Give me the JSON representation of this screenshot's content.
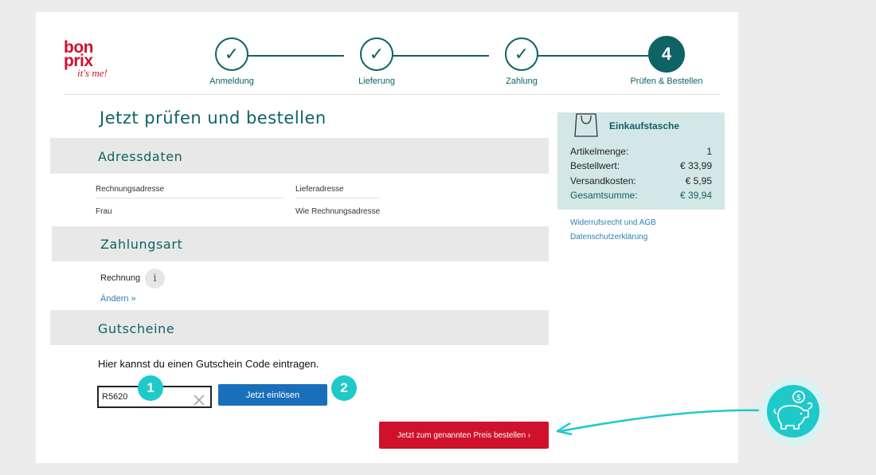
{
  "logo": {
    "line1": "bon",
    "line2": "prix",
    "line3": "it's me!"
  },
  "steps": [
    {
      "label": "Anmeldung",
      "mark": "✓"
    },
    {
      "label": "Lieferung",
      "mark": "✓"
    },
    {
      "label": "Zahlung",
      "mark": "✓"
    },
    {
      "label": "Prüfen & Bestellen",
      "mark": "4"
    }
  ],
  "page_title": "Jetzt prüfen und bestellen",
  "address": {
    "section_title": "Adressdaten",
    "billing_header": "Rechnungsadresse",
    "billing_value": "Frau",
    "shipping_header": "Lieferadresse",
    "shipping_value": "Wie Rechnungsadresse"
  },
  "payment": {
    "section_title": "Zahlungsart",
    "method": "Rechnung",
    "info_glyph": "i",
    "change_link": "Ändern »"
  },
  "voucher": {
    "section_title": "Gutscheine",
    "hint": "Hier kannst du einen Gutschein Code eintragen.",
    "code_value": "R5620",
    "redeem_label": "Jetzt einlösen"
  },
  "order_button_label": "Jetzt zum genannten Preis bestellen  ›",
  "badges": [
    "1",
    "2"
  ],
  "summary": {
    "title": "Einkaufstasche",
    "rows": [
      {
        "label": "Artikelmenge:",
        "value": "1"
      },
      {
        "label": "Bestellwert:",
        "value": "€ 33,99"
      },
      {
        "label": "Versandkosten:",
        "value": "€ 5,95"
      },
      {
        "label": "Gesamtsumme:",
        "value": "€ 39,94"
      }
    ]
  },
  "links": {
    "terms": "Widerrufsrecht und AGB",
    "privacy": "Datenschutzerklärung"
  },
  "colors": {
    "brand": "#d0112b",
    "primary_teal": "#0e6365",
    "accent_cyan": "#1fc9c9",
    "button_blue": "#1a6fbb"
  }
}
